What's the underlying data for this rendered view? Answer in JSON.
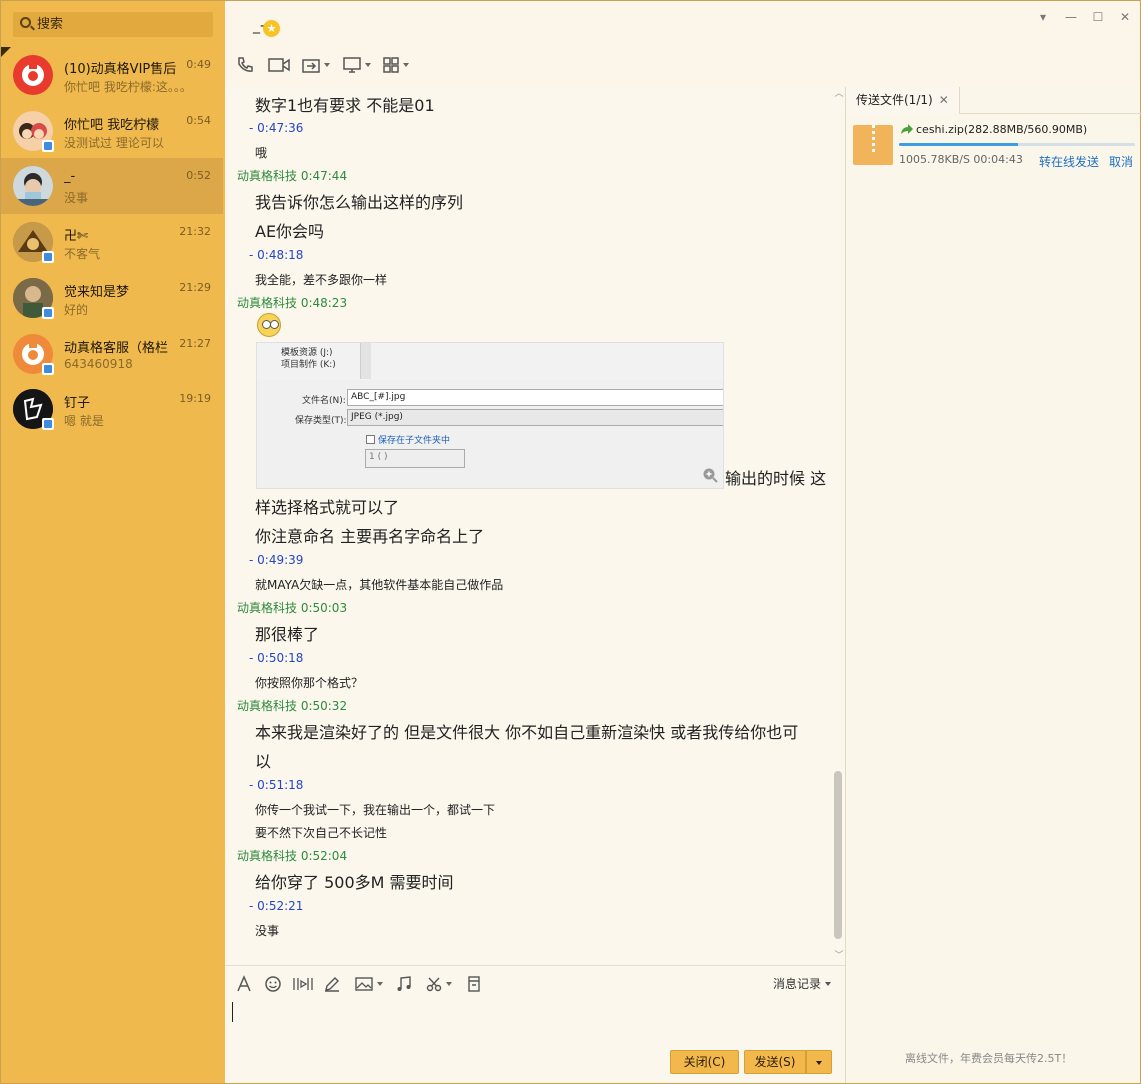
{
  "search": {
    "placeholder": "搜索"
  },
  "conversations": [
    {
      "name": "(10)动真格VIP售后",
      "preview": "你忙吧 我吃柠檬:这。。。",
      "time": "0:49",
      "avatar_color": "#e83b2e"
    },
    {
      "name": "你忙吧 我吃柠檬",
      "preview": "没测试过 理论可以",
      "time": "0:54",
      "avatar_color": "#e99a74"
    },
    {
      "name": "_-",
      "preview": "没事",
      "time": "0:52",
      "avatar_color": "#8fb3c8"
    },
    {
      "name": "卍✄",
      "preview": "不客气",
      "time": "21:32",
      "avatar_color": "#b07d2a"
    },
    {
      "name": "觉来知是梦",
      "preview": "好的",
      "time": "21:29",
      "avatar_color": "#6b5a3a"
    },
    {
      "name": "动真格客服（格栏",
      "preview": "643460918",
      "time": "21:27",
      "avatar_color": "#ef8a3a"
    },
    {
      "name": "钉子",
      "preview": "嗯 就是",
      "time": "19:19",
      "avatar_color": "#151515"
    }
  ],
  "header": {
    "title": "_-"
  },
  "messages": {
    "m1": "数字1也有要求  不能是01",
    "t1": "-   0:47:36",
    "m2": "哦",
    "p1": "动真格科技   0:47:44",
    "m3": "我告诉你怎么输出这样的序列",
    "m4": "AE你会吗",
    "t2": "-   0:48:18",
    "m5": "我全能，差不多跟你一样",
    "p2": "动真格科技   0:48:23",
    "m6a": "输出的时候 这",
    "m6b": "样选择格式就可以了",
    "m7": "你注意命名 主要再名字命名上了",
    "t3": "-   0:49:39",
    "m8": "就MAYA欠缺一点，其他软件基本能自己做作品",
    "p3": "动真格科技   0:50:03",
    "m9": "那很棒了",
    "t4": "-   0:50:18",
    "m10": "你按照你那个格式？",
    "p4": "动真格科技   0:50:32",
    "m11a": "本来我是渲染好了的 但是文件很大 你不如自己重新渲染快 或者我传给你也可",
    "m11b": "以",
    "t5": "-   0:51:18",
    "m12": "你传一个我试一下，我在输出一个，都试一下",
    "m13": "要不然下次自己不长记性",
    "p5": "动真格科技   0:52:04",
    "m14": "给你穿了 500多M 需要时间",
    "t6": "-   0:52:21",
    "m15": "没事"
  },
  "screenshot": {
    "drive1": "模板资源 (J:)",
    "drive2": "项目制作 (K:)",
    "filename_label": "文件名(N):",
    "filename_value": "ABC_[#].jpg",
    "type_label": "保存类型(T):",
    "type_value": "JPEG (*.jpg)",
    "subfolder": "保存在子文件夹中",
    "sub_value": "1 ( )"
  },
  "input": {
    "history": "消息记录",
    "close_btn": "关闭(C)",
    "send_btn": "发送(S)"
  },
  "transfer": {
    "tab": "传送文件(1/1)",
    "file": "ceshi.zip(282.88MB/560.90MB)",
    "progress": 0.504,
    "speed": "1005.78KB/S   00:04:43",
    "offline": "转在线发送",
    "cancel": "取消",
    "footer": "离线文件，年费会员每天传2.5T！"
  },
  "colors": {
    "sidebar": "#efb94e",
    "peer_time": "#2e8b3c",
    "self_time": "#2346c8",
    "link": "#1f6fc4"
  }
}
